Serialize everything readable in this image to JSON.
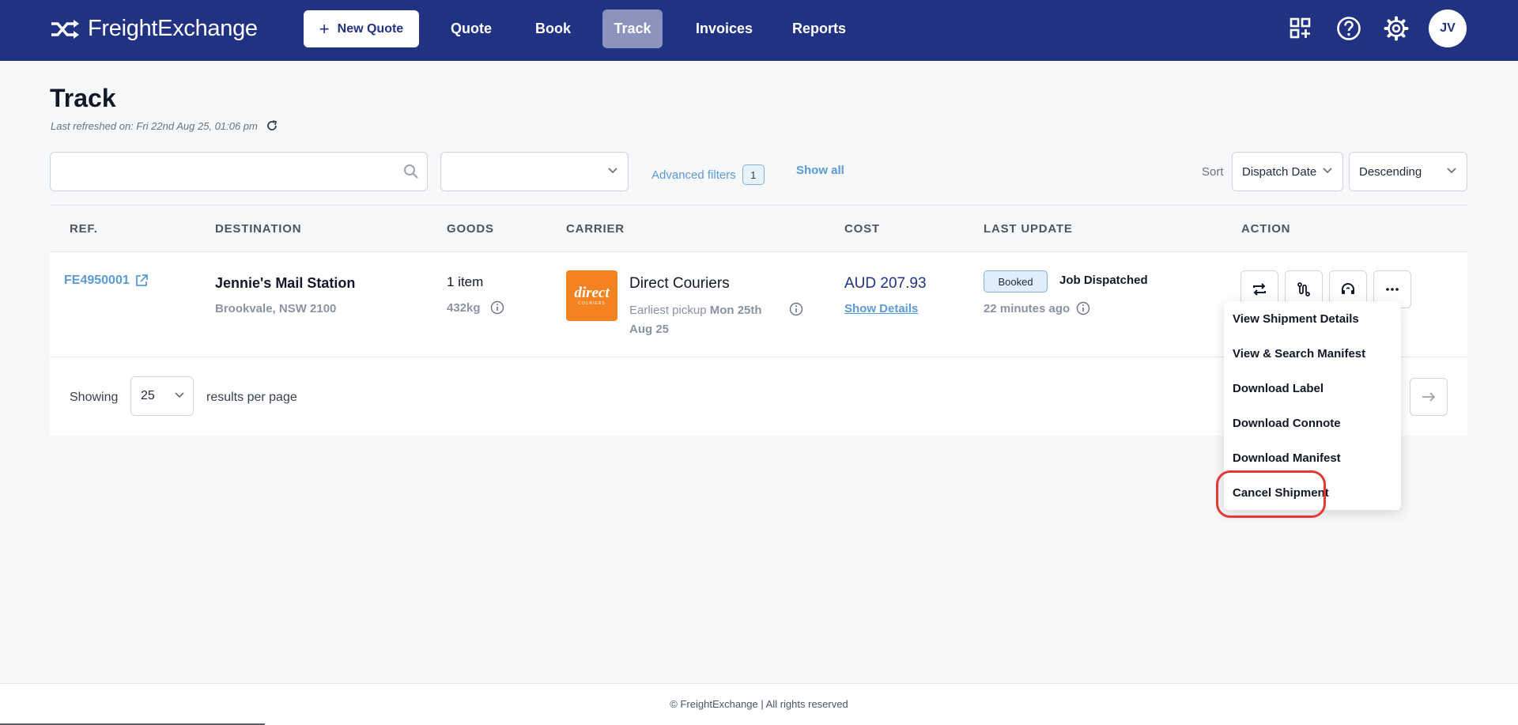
{
  "app": {
    "brand": "FreightExchange",
    "colors": {
      "nav_bg": "#213282",
      "accent_link": "#5b9bd5",
      "active_tab": "#8b93bd",
      "highlight": "#e53935"
    }
  },
  "nav": {
    "new_quote_label": "New Quote",
    "items": [
      {
        "label": "Quote"
      },
      {
        "label": "Book"
      },
      {
        "label": "Track",
        "active": true
      },
      {
        "label": "Invoices"
      },
      {
        "label": "Reports"
      }
    ],
    "icons": [
      "apps-add-icon",
      "help-icon",
      "settings-icon"
    ],
    "avatar_initials": "JV"
  },
  "page": {
    "title": "Track",
    "last_refreshed": "Last refreshed on: Fri 22nd Aug 25, 01:06 pm"
  },
  "filters": {
    "search_value": "",
    "select_value": "",
    "advanced_label": "Advanced filters",
    "advanced_count": "1",
    "show_all_label": "Show all",
    "sort_label": "Sort",
    "sort_field": "Dispatch Date",
    "sort_order": "Descending"
  },
  "table": {
    "headers": [
      "REF.",
      "DESTINATION",
      "GOODS",
      "CARRIER",
      "COST",
      "LAST UPDATE",
      "ACTION"
    ],
    "rows": [
      {
        "ref": "FE4950001",
        "destination_name": "Jennie's Mail Station",
        "destination_address": "Brookvale, NSW 2100",
        "goods_items": "1 item",
        "goods_weight": "432kg",
        "carrier_logo_main": "direct",
        "carrier_logo_sub": "COURIERS",
        "carrier_name": "Direct Couriers",
        "pickup_label": "Earliest pickup",
        "pickup_date": "Mon 25th Aug 25",
        "cost": "AUD 207.93",
        "cost_link": "Show Details",
        "status_badge": "Booked",
        "status_text": "Job Dispatched",
        "updated": "22 minutes ago",
        "action_icons": [
          "repeat-icon",
          "route-icon",
          "support-icon",
          "more-icon"
        ]
      }
    ]
  },
  "pagination": {
    "showing_label": "Showing",
    "per_page": "25",
    "results_label": "results per page"
  },
  "action_menu": {
    "items": [
      "View Shipment Details",
      "View & Search Manifest",
      "Download Label",
      "Download Connote",
      "Download Manifest",
      "Cancel Shipment"
    ]
  },
  "footer": {
    "text": "© FreightExchange | All rights reserved"
  }
}
